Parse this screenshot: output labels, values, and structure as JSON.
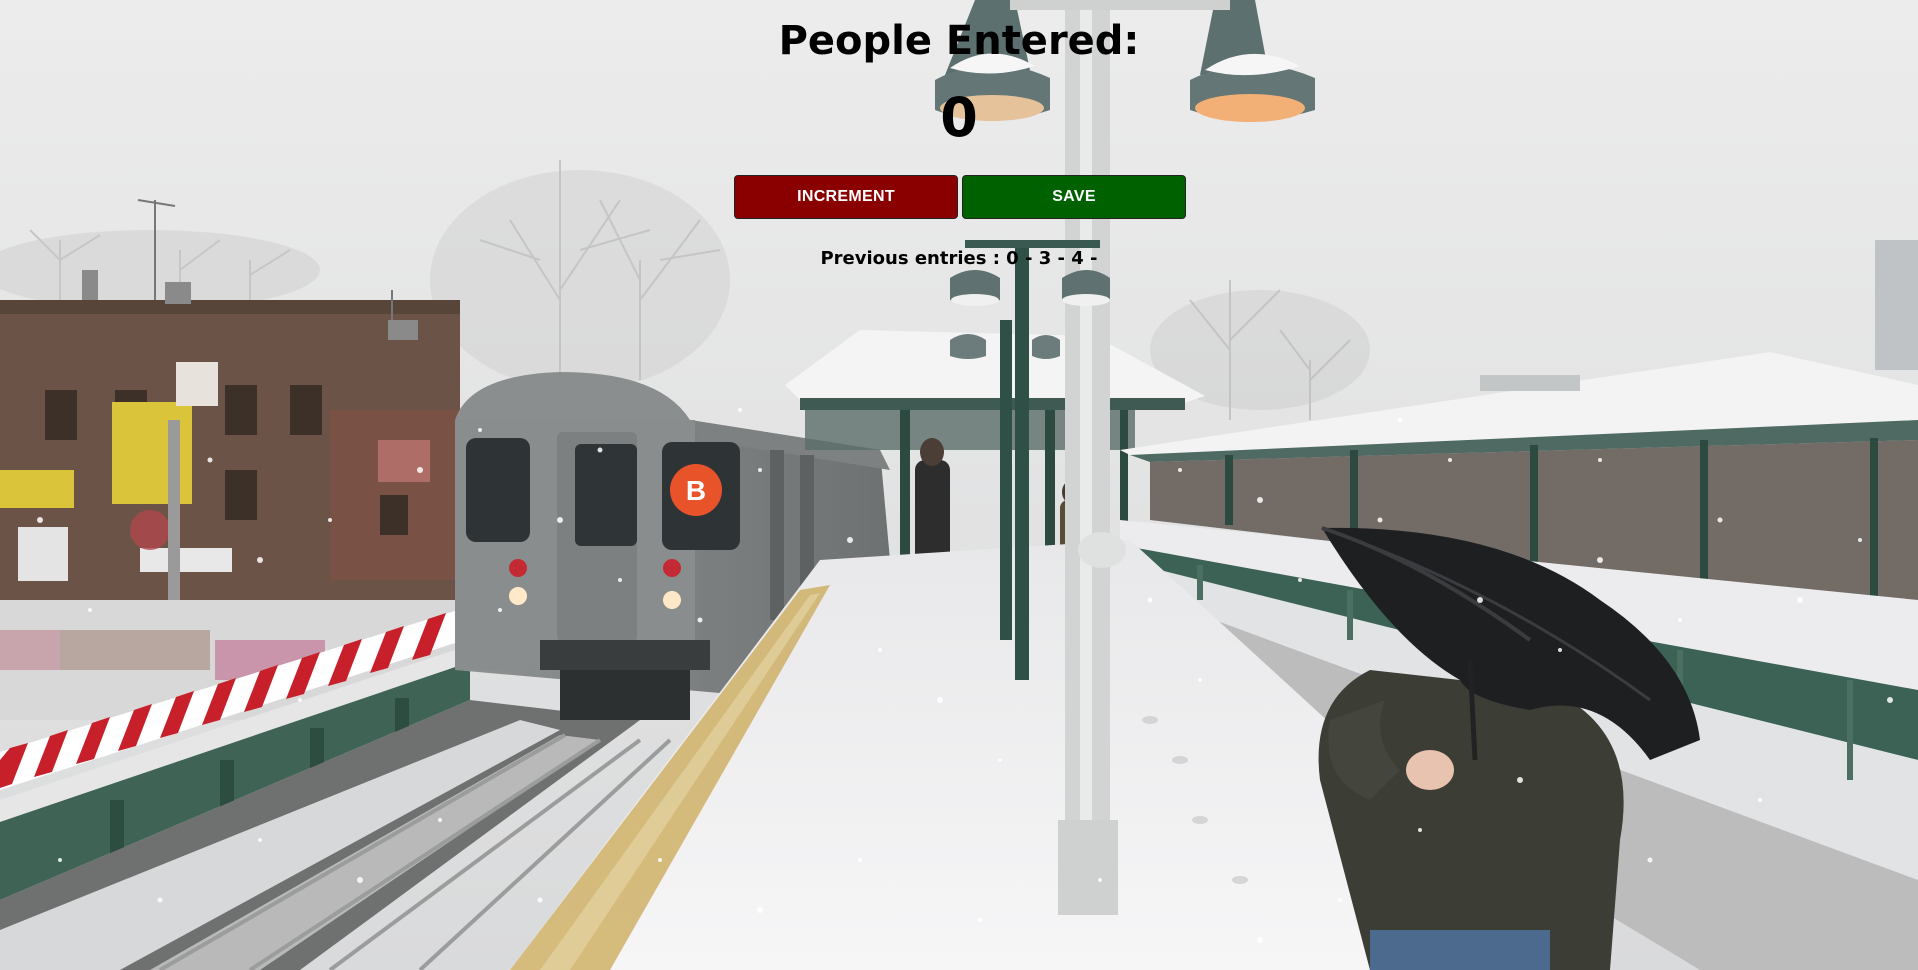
{
  "counter": {
    "title": "People Entered:",
    "count": "0"
  },
  "buttons": {
    "increment_label": "INCREMENT",
    "save_label": "SAVE"
  },
  "entries": {
    "label": "Previous entries :",
    "values": "0 - 3 - 4 -"
  },
  "background": {
    "train_badge": "B"
  },
  "colors": {
    "increment_bg": "#8a0000",
    "save_bg": "#006100"
  }
}
